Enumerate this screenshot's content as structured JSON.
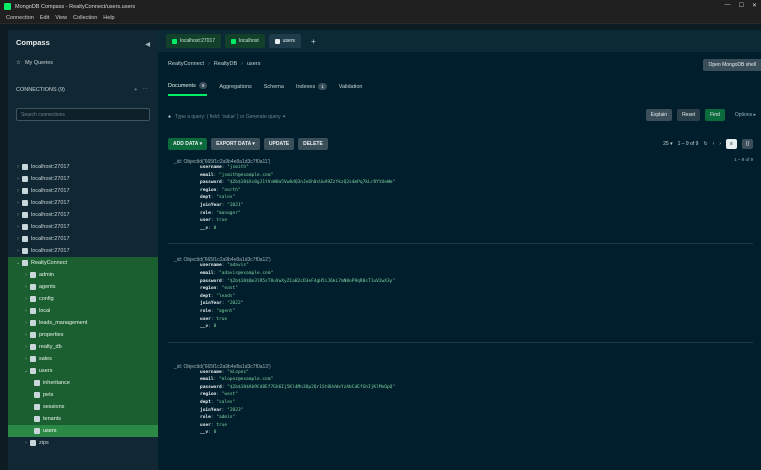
{
  "window": {
    "title": "MongoDB Compass - RealtyConnect/users.users",
    "controls": [
      "—",
      "☐",
      "✕"
    ]
  },
  "menu": [
    "Connection",
    "Edit",
    "View",
    "Collection",
    "Help"
  ],
  "sidebar": {
    "title": "Compass",
    "my_queries": "My Queries",
    "connections_label": "CONNECTIONS (9)",
    "search_placeholder": "Search connections",
    "connections": [
      "localhost:27017",
      "localhost:27017",
      "localhost:27017",
      "localhost:27017",
      "localhost:27017",
      "localhost:27017",
      "localhost:27017",
      "localhost:27017"
    ],
    "active_connection": "RealtyConnect",
    "databases": [
      "admin",
      "agents",
      "config",
      "local",
      "leads_management",
      "properties",
      "realty_db",
      "sales",
      "users"
    ],
    "collections": [
      "inheritance",
      "pets",
      "sessions",
      "tenants",
      "users"
    ],
    "trailing_db": "zips"
  },
  "tabs": [
    {
      "label": "localhost:27017"
    },
    {
      "label": "localhost"
    },
    {
      "label": "users"
    }
  ],
  "breadcrumb": [
    "RealtyConnect",
    "RealtyDB",
    "users"
  ],
  "shell_button": "Open MongoDB shell",
  "subtabs": [
    {
      "label": "Documents",
      "badge": "9"
    },
    {
      "label": "Aggregations",
      "badge": ""
    },
    {
      "label": "Schema",
      "badge": ""
    },
    {
      "label": "Indexes",
      "badge": "1"
    },
    {
      "label": "Validation",
      "badge": ""
    }
  ],
  "query": {
    "placeholder": "Type a query: { field: 'value' } or Generate query ✦",
    "buttons": {
      "explain": "Explain",
      "reset": "Reset",
      "find": "Find",
      "options": "Options ▸"
    }
  },
  "toolbar": {
    "add": "ADD DATA ▾",
    "export": "EXPORT DATA ▾",
    "update": "UPDATE",
    "delete": "DELETE"
  },
  "pager": {
    "page_size": "25 ▾",
    "range": "1 – 9 of 9",
    "summary": "1 – 9 of 9"
  },
  "documents": [
    {
      "id": "_id: ObjectId('665f1c2a9b4e8a1d3c7f0a11')",
      "fields": [
        {
          "k": "username",
          "v": "\"jsmith\""
        },
        {
          "k": "email",
          "v": "\"jsmith@example.com\""
        },
        {
          "k": "password",
          "v": "\"$2b$10$Xv8gJ1tVvW0a5Vw0dQ3nJe6h0cUuA9ZzYkzQ2s4mPq7kLr8YtUeWm\""
        },
        {
          "k": "region",
          "v": "\"north\""
        },
        {
          "k": "dept",
          "v": "\"sales\""
        },
        {
          "k": "joinYear",
          "v": "\"2021\""
        },
        {
          "k": "role",
          "v": "\"manager\""
        },
        {
          "k": "user",
          "v": "true"
        },
        {
          "k": "__v",
          "v": "0"
        }
      ]
    },
    {
      "id": "_id: ObjectId('665f1c2a9b4e8a1d3c7f0a12')",
      "fields": [
        {
          "k": "username",
          "v": "\"adavis\""
        },
        {
          "k": "email",
          "v": "\"adavis@example.com\""
        },
        {
          "k": "password",
          "v": "\"$2b$10$Qm3lR5sT8uVwXyZ1aB2cD3eF4gH5iJ6kL7mN8oP9qR0sT1uV2wX3y\""
        },
        {
          "k": "region",
          "v": "\"east\""
        },
        {
          "k": "dept",
          "v": "\"leads\""
        },
        {
          "k": "joinYear",
          "v": "\"2022\""
        },
        {
          "k": "role",
          "v": "\"agent\""
        },
        {
          "k": "user",
          "v": "true"
        },
        {
          "k": "__v",
          "v": "0"
        }
      ]
    },
    {
      "id": "_id: ObjectId('665f1c2a9b4e8a1d3c7f0a13')",
      "fields": [
        {
          "k": "username",
          "v": "\"mlopez\""
        },
        {
          "k": "email",
          "v": "\"mlopez@example.com\""
        },
        {
          "k": "password",
          "v": "\"$2b$10$Ab9Cd8Ef7Gh6Ij5Kl4Mn3Op2Qr1St0UvWxYzAbCdEfGhIjKlMnOpQ\""
        },
        {
          "k": "region",
          "v": "\"west\""
        },
        {
          "k": "dept",
          "v": "\"sales\""
        },
        {
          "k": "joinYear",
          "v": "\"2023\""
        },
        {
          "k": "role",
          "v": "\"admin\""
        },
        {
          "k": "user",
          "v": "true"
        },
        {
          "k": "__v",
          "v": "0"
        }
      ]
    }
  ]
}
